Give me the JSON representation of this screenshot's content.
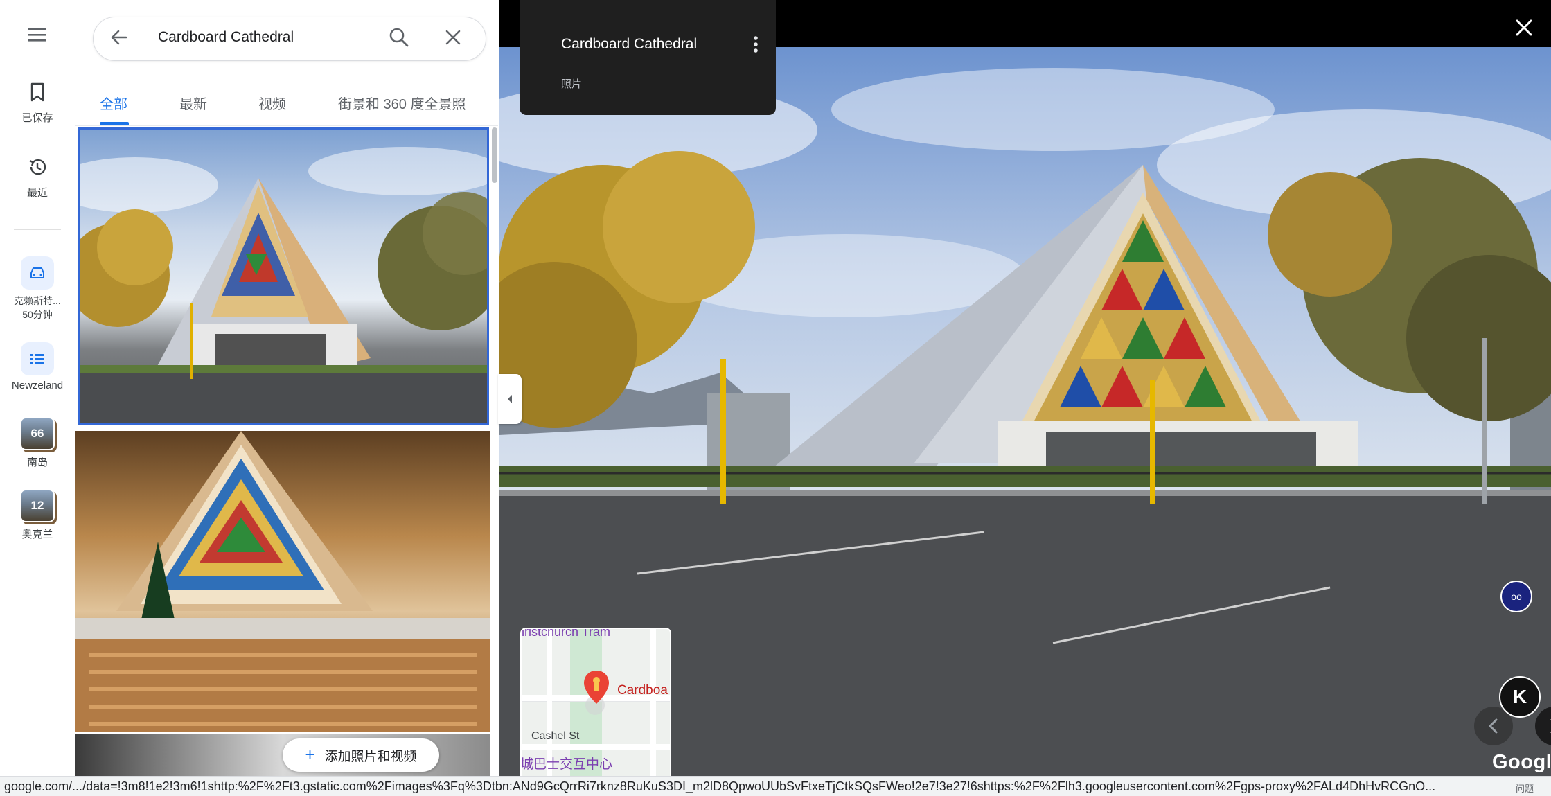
{
  "rail": {
    "saved_label": "已保存",
    "recent_label": "最近",
    "drive_label": "克赖斯特...",
    "drive_time": "50分钟",
    "list_label": "Newzeland",
    "south_island_count": "66",
    "south_island_label": "南岛",
    "auckland_count": "12",
    "auckland_label": "奥克兰"
  },
  "search": {
    "query": "Cardboard Cathedral"
  },
  "tabs": [
    "全部",
    "最新",
    "视频",
    "街景和 360 度全景照"
  ],
  "panel": {
    "add_photo_label": "添加照片和视频"
  },
  "viewer": {
    "title": "Cardboard Cathedral",
    "subtitle": "照片",
    "google_label": "Google",
    "minimap": {
      "top_label": "hristchurch Tram",
      "place_label": "Cardboa",
      "street_label": "Cashel St",
      "bus_label": "城巴士交互中心"
    }
  },
  "status_bar": {
    "url": "google.com/.../data=!3m8!1e2!3m6!1shttp:%2F%2Ft3.gstatic.com%2Fimages%3Fq%3Dtbn:ANd9GcQrrRi7rknz8RuKuS3DI_m2lD8QpwoUUbSvFtxeTjCtkSQsFWeo!2e7!3e27!6shttps:%2F%2Flh3.googleusercontent.com%2Fgps-proxy%2FALd4DhHvRCGnO...",
    "edge_text": "问题"
  },
  "colors": {
    "accent": "#1a73e8",
    "selected_border": "#3367d6",
    "viewer_bg": "#000000"
  }
}
